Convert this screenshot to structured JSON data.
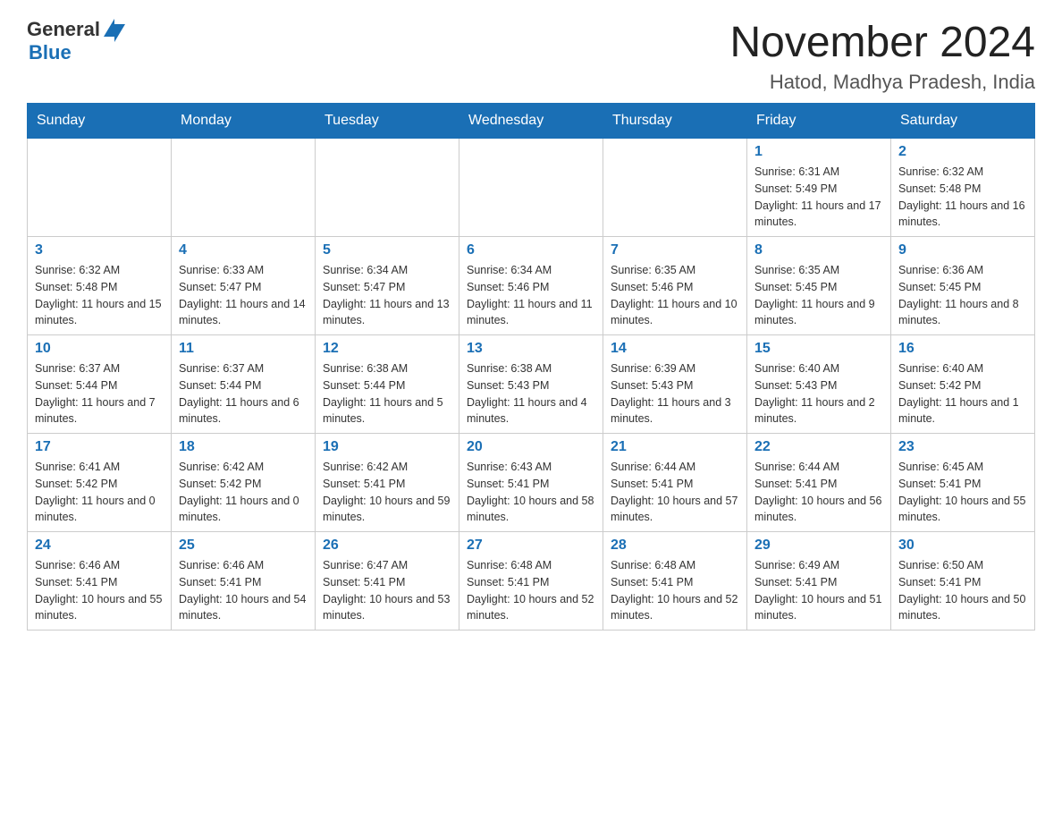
{
  "header": {
    "logo": {
      "text_general": "General",
      "text_blue": "Blue",
      "aria": "GeneralBlue logo"
    },
    "title": "November 2024",
    "subtitle": "Hatod, Madhya Pradesh, India"
  },
  "calendar": {
    "weekdays": [
      "Sunday",
      "Monday",
      "Tuesday",
      "Wednesday",
      "Thursday",
      "Friday",
      "Saturday"
    ],
    "weeks": [
      [
        {
          "day": "",
          "info": ""
        },
        {
          "day": "",
          "info": ""
        },
        {
          "day": "",
          "info": ""
        },
        {
          "day": "",
          "info": ""
        },
        {
          "day": "",
          "info": ""
        },
        {
          "day": "1",
          "info": "Sunrise: 6:31 AM\nSunset: 5:49 PM\nDaylight: 11 hours and 17 minutes."
        },
        {
          "day": "2",
          "info": "Sunrise: 6:32 AM\nSunset: 5:48 PM\nDaylight: 11 hours and 16 minutes."
        }
      ],
      [
        {
          "day": "3",
          "info": "Sunrise: 6:32 AM\nSunset: 5:48 PM\nDaylight: 11 hours and 15 minutes."
        },
        {
          "day": "4",
          "info": "Sunrise: 6:33 AM\nSunset: 5:47 PM\nDaylight: 11 hours and 14 minutes."
        },
        {
          "day": "5",
          "info": "Sunrise: 6:34 AM\nSunset: 5:47 PM\nDaylight: 11 hours and 13 minutes."
        },
        {
          "day": "6",
          "info": "Sunrise: 6:34 AM\nSunset: 5:46 PM\nDaylight: 11 hours and 11 minutes."
        },
        {
          "day": "7",
          "info": "Sunrise: 6:35 AM\nSunset: 5:46 PM\nDaylight: 11 hours and 10 minutes."
        },
        {
          "day": "8",
          "info": "Sunrise: 6:35 AM\nSunset: 5:45 PM\nDaylight: 11 hours and 9 minutes."
        },
        {
          "day": "9",
          "info": "Sunrise: 6:36 AM\nSunset: 5:45 PM\nDaylight: 11 hours and 8 minutes."
        }
      ],
      [
        {
          "day": "10",
          "info": "Sunrise: 6:37 AM\nSunset: 5:44 PM\nDaylight: 11 hours and 7 minutes."
        },
        {
          "day": "11",
          "info": "Sunrise: 6:37 AM\nSunset: 5:44 PM\nDaylight: 11 hours and 6 minutes."
        },
        {
          "day": "12",
          "info": "Sunrise: 6:38 AM\nSunset: 5:44 PM\nDaylight: 11 hours and 5 minutes."
        },
        {
          "day": "13",
          "info": "Sunrise: 6:38 AM\nSunset: 5:43 PM\nDaylight: 11 hours and 4 minutes."
        },
        {
          "day": "14",
          "info": "Sunrise: 6:39 AM\nSunset: 5:43 PM\nDaylight: 11 hours and 3 minutes."
        },
        {
          "day": "15",
          "info": "Sunrise: 6:40 AM\nSunset: 5:43 PM\nDaylight: 11 hours and 2 minutes."
        },
        {
          "day": "16",
          "info": "Sunrise: 6:40 AM\nSunset: 5:42 PM\nDaylight: 11 hours and 1 minute."
        }
      ],
      [
        {
          "day": "17",
          "info": "Sunrise: 6:41 AM\nSunset: 5:42 PM\nDaylight: 11 hours and 0 minutes."
        },
        {
          "day": "18",
          "info": "Sunrise: 6:42 AM\nSunset: 5:42 PM\nDaylight: 11 hours and 0 minutes."
        },
        {
          "day": "19",
          "info": "Sunrise: 6:42 AM\nSunset: 5:41 PM\nDaylight: 10 hours and 59 minutes."
        },
        {
          "day": "20",
          "info": "Sunrise: 6:43 AM\nSunset: 5:41 PM\nDaylight: 10 hours and 58 minutes."
        },
        {
          "day": "21",
          "info": "Sunrise: 6:44 AM\nSunset: 5:41 PM\nDaylight: 10 hours and 57 minutes."
        },
        {
          "day": "22",
          "info": "Sunrise: 6:44 AM\nSunset: 5:41 PM\nDaylight: 10 hours and 56 minutes."
        },
        {
          "day": "23",
          "info": "Sunrise: 6:45 AM\nSunset: 5:41 PM\nDaylight: 10 hours and 55 minutes."
        }
      ],
      [
        {
          "day": "24",
          "info": "Sunrise: 6:46 AM\nSunset: 5:41 PM\nDaylight: 10 hours and 55 minutes."
        },
        {
          "day": "25",
          "info": "Sunrise: 6:46 AM\nSunset: 5:41 PM\nDaylight: 10 hours and 54 minutes."
        },
        {
          "day": "26",
          "info": "Sunrise: 6:47 AM\nSunset: 5:41 PM\nDaylight: 10 hours and 53 minutes."
        },
        {
          "day": "27",
          "info": "Sunrise: 6:48 AM\nSunset: 5:41 PM\nDaylight: 10 hours and 52 minutes."
        },
        {
          "day": "28",
          "info": "Sunrise: 6:48 AM\nSunset: 5:41 PM\nDaylight: 10 hours and 52 minutes."
        },
        {
          "day": "29",
          "info": "Sunrise: 6:49 AM\nSunset: 5:41 PM\nDaylight: 10 hours and 51 minutes."
        },
        {
          "day": "30",
          "info": "Sunrise: 6:50 AM\nSunset: 5:41 PM\nDaylight: 10 hours and 50 minutes."
        }
      ]
    ]
  }
}
